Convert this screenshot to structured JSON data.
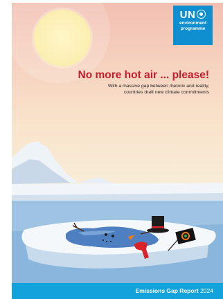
{
  "logo": {
    "un": "UN",
    "line1": "environment",
    "line2": "programme"
  },
  "cover": {
    "headline": "No more hot air ... please!",
    "subtitle_line1": "With a massive gap between rhetoric and reality,",
    "subtitle_line2": "countries draft new climate commitments"
  },
  "footer": {
    "report_title": "Emissions Gap Report",
    "year": "2024"
  },
  "colors": {
    "headline": "#c51d2c",
    "footer_band": "#12a2dc",
    "logo_box": "#0f8ed0",
    "sky_top": "#f2bfb2",
    "sun": "#fbeeb0"
  }
}
